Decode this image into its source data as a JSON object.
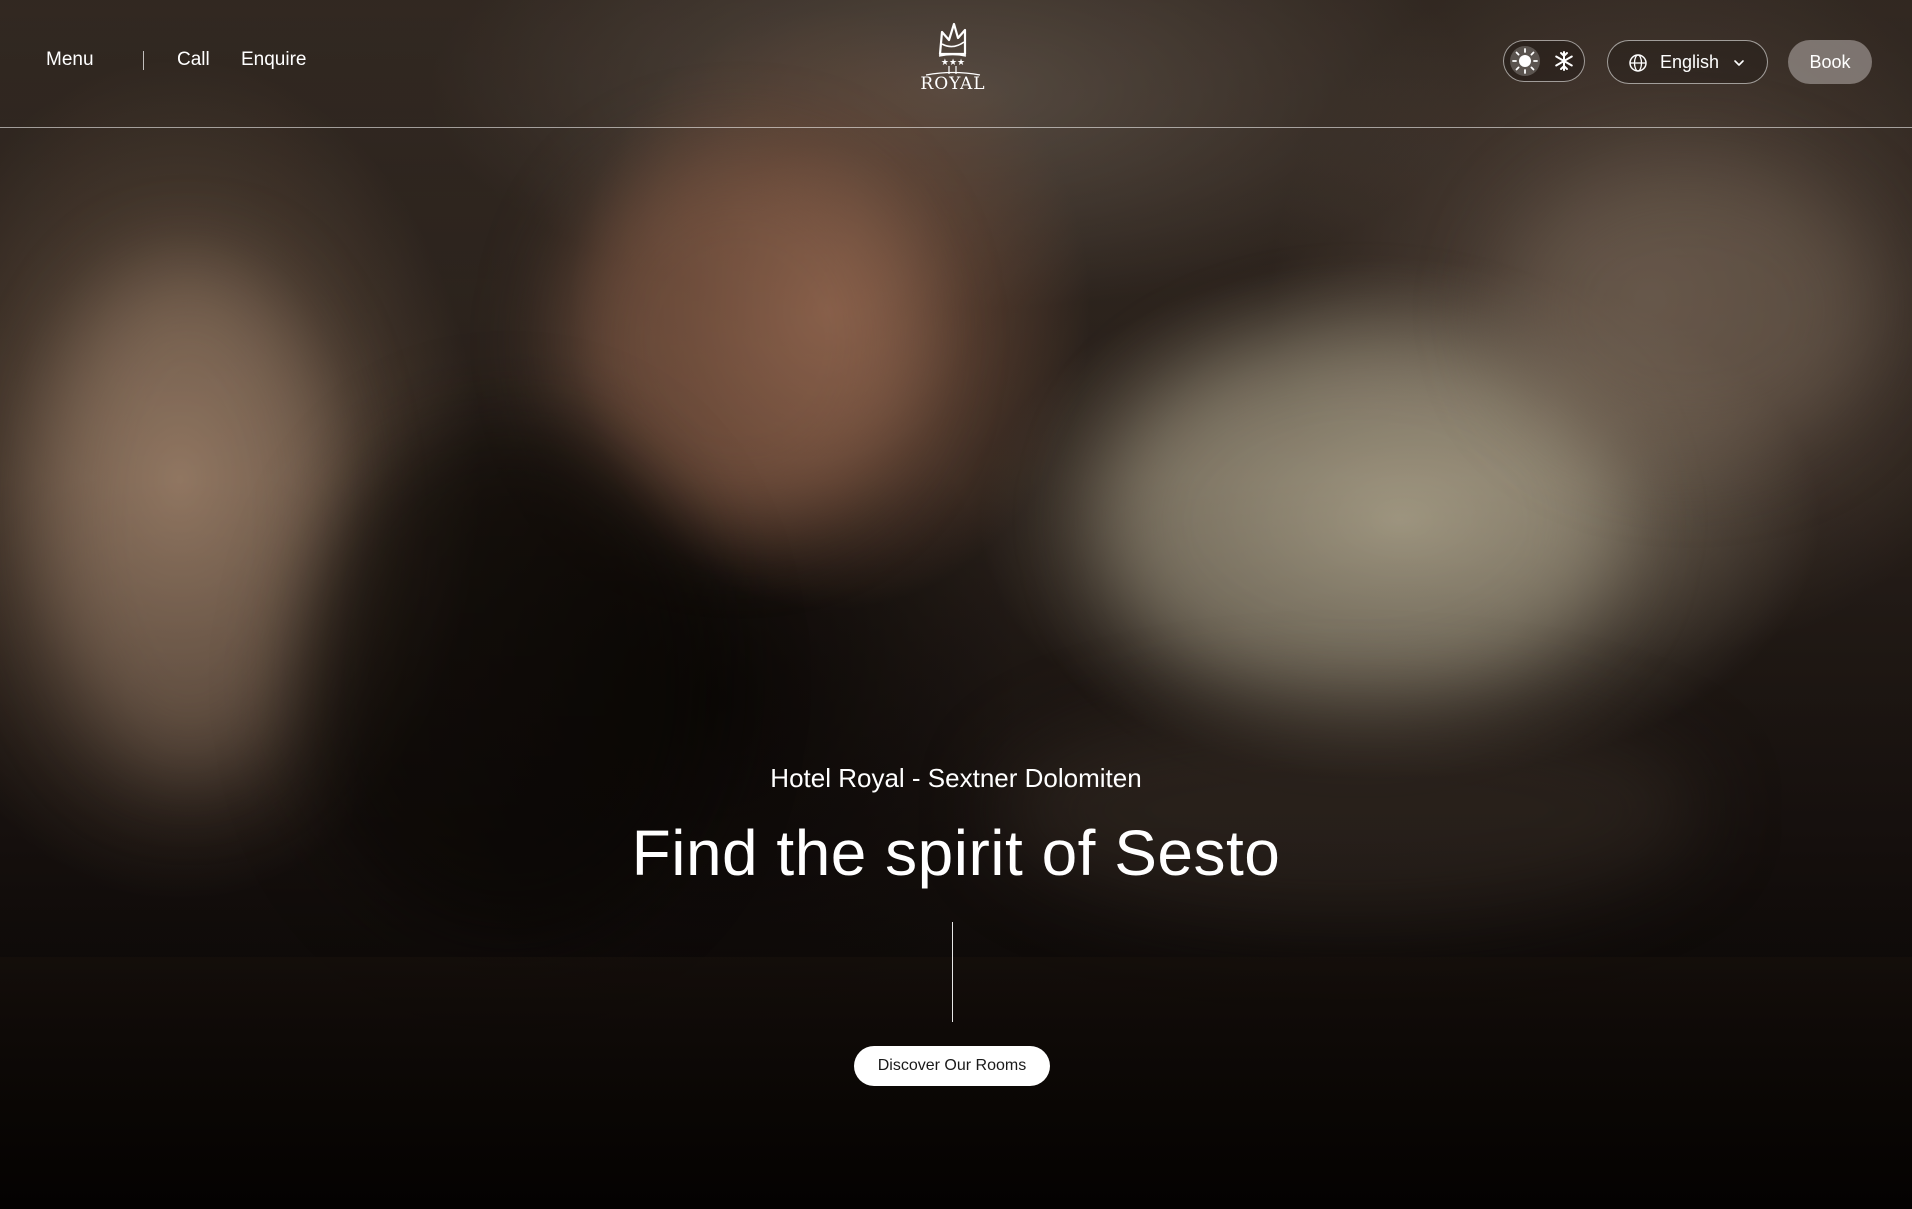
{
  "header": {
    "menu_label": "Menu",
    "call_label": "Call",
    "enquire_label": "Enquire",
    "logo_text": "ROYAL",
    "theme_icons": [
      "sun-icon",
      "snowflake-icon"
    ],
    "language": {
      "selected": "English",
      "icon": "globe-icon"
    },
    "book_label": "Book"
  },
  "hero": {
    "eyebrow": "Hotel Royal - Sextner Dolomiten",
    "headline": "Find the spirit of Sesto",
    "cta_label": "Discover Our Rooms"
  },
  "colors": {
    "cta_background": "#ffffff",
    "book_background": "#968e8a",
    "text": "#ffffff"
  }
}
